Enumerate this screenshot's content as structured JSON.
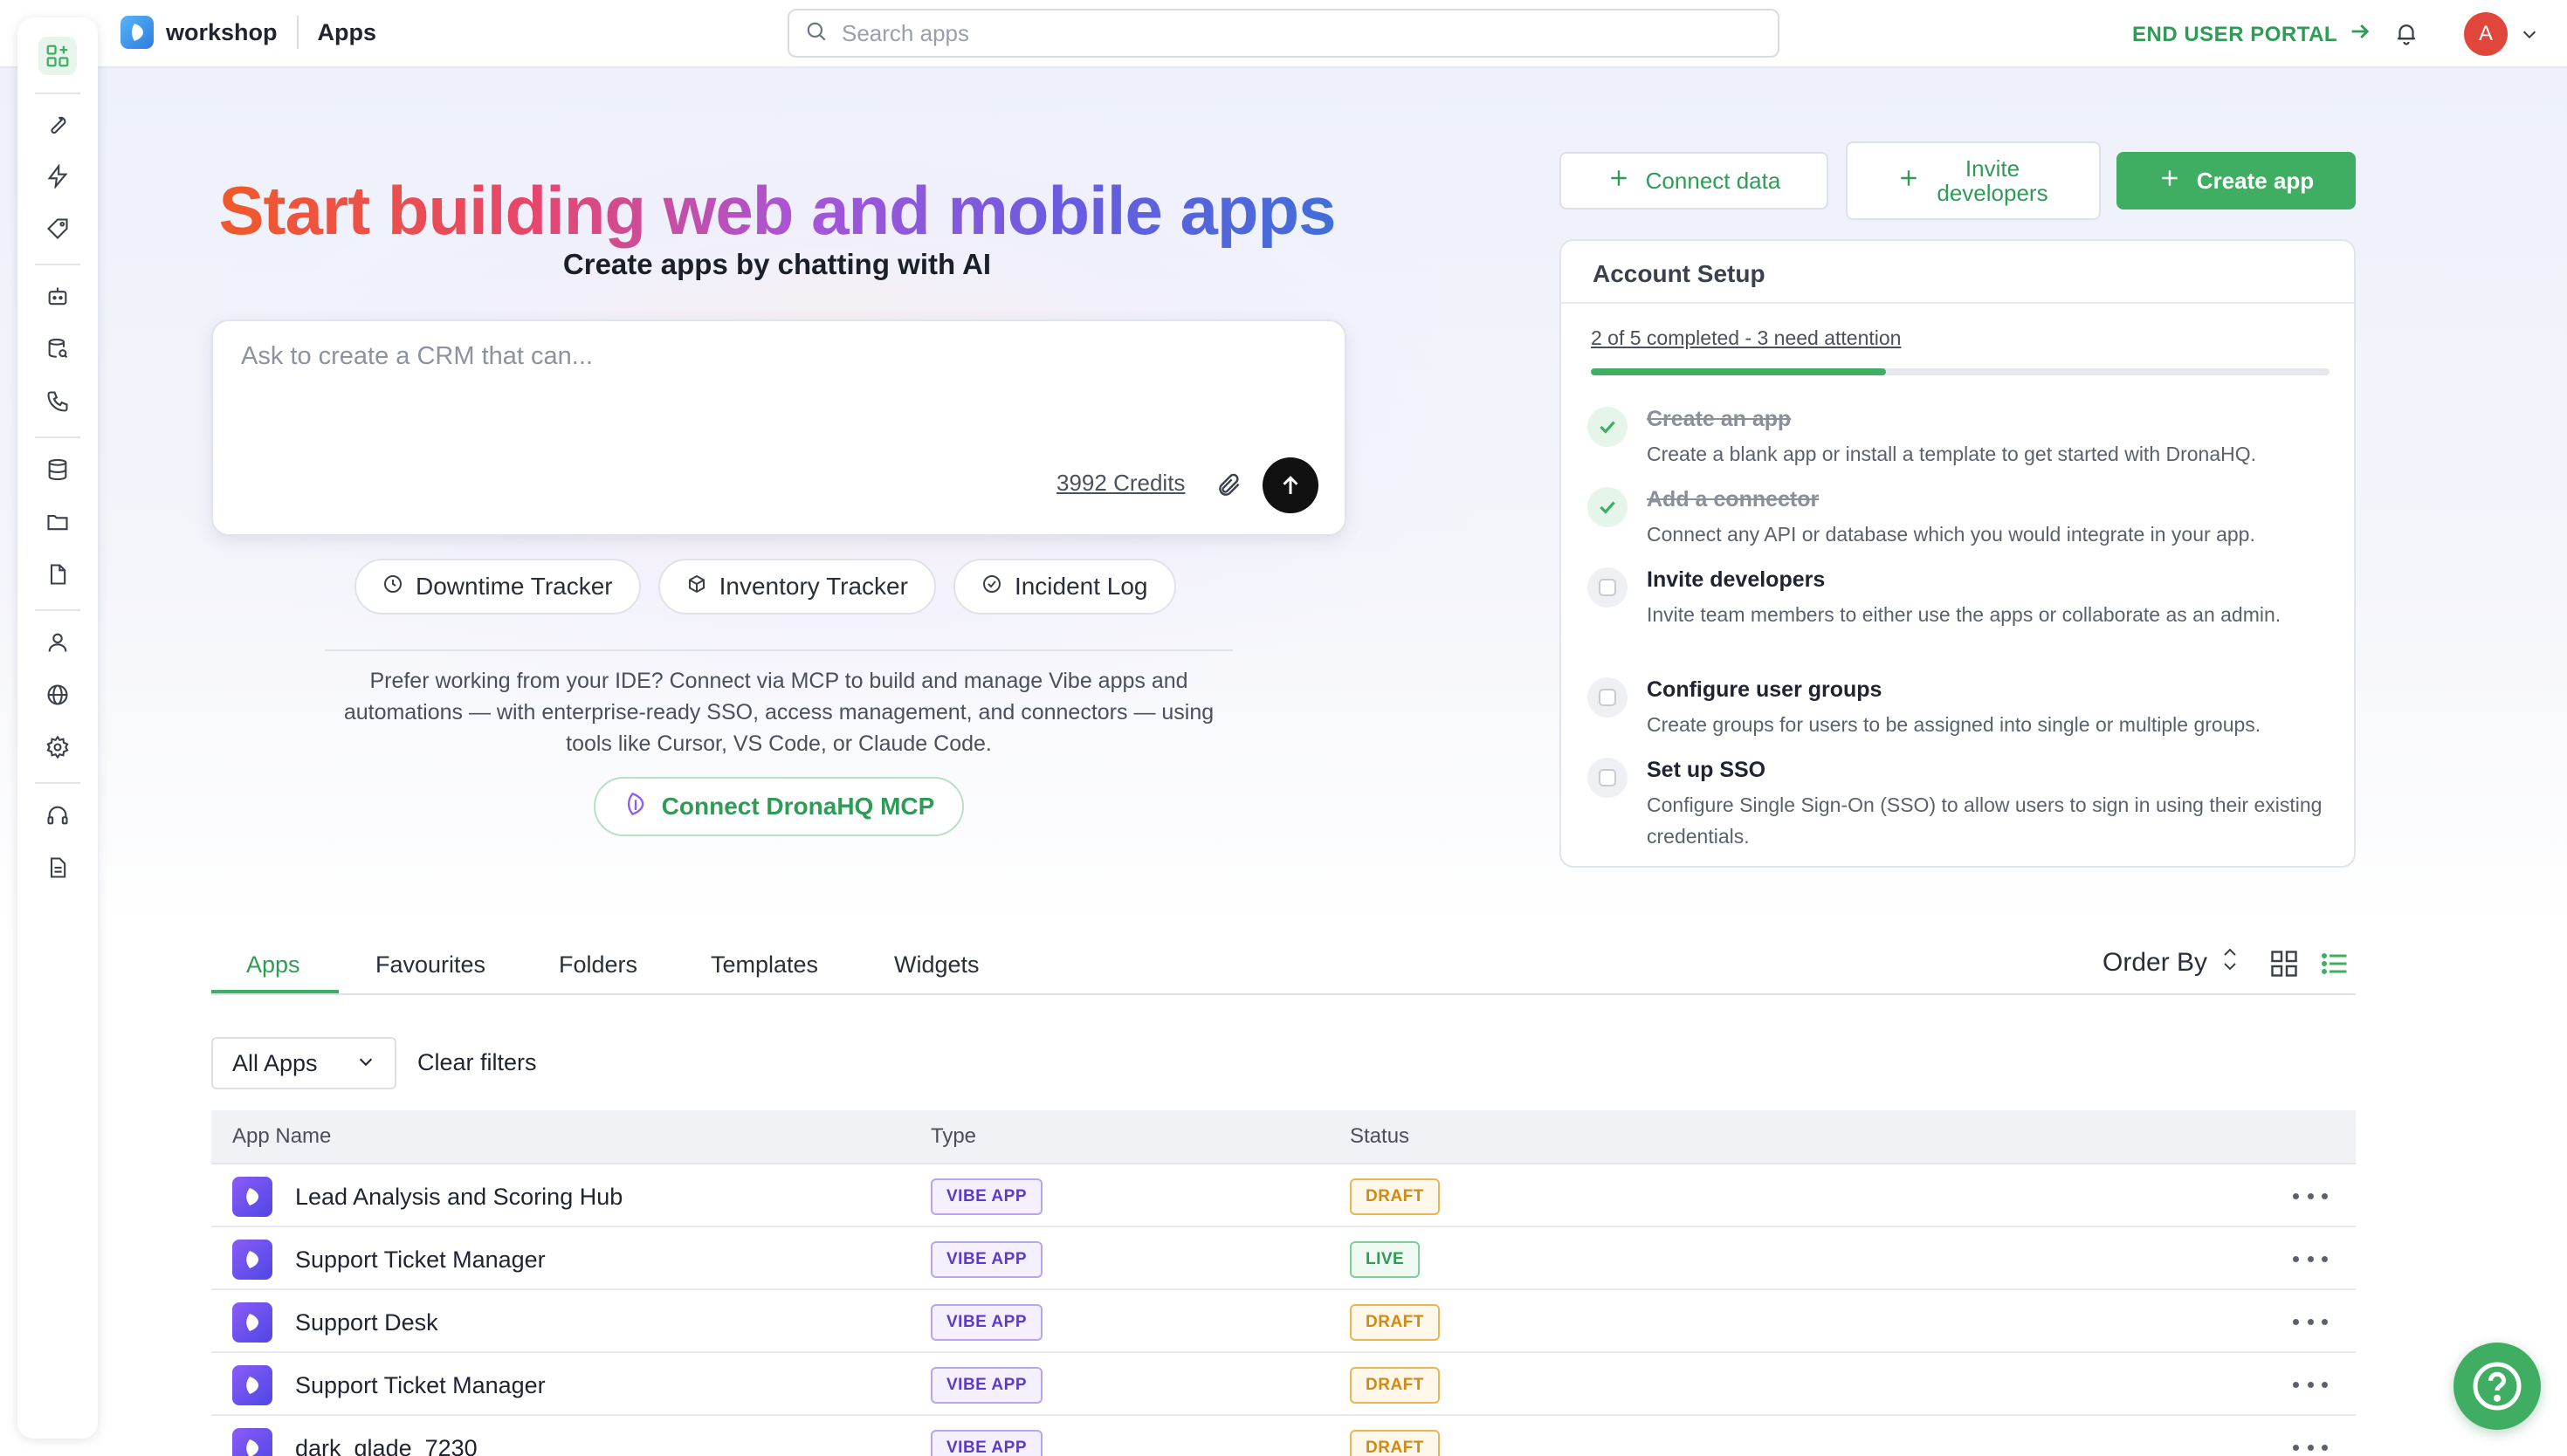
{
  "brand": {
    "name": "workshop",
    "section": "Apps"
  },
  "search": {
    "placeholder": "Search apps"
  },
  "header": {
    "portal_label": "END USER PORTAL",
    "avatar_initial": "A"
  },
  "colors": {
    "accent": "#3fae62",
    "accent_text": "#2f9b57",
    "avatar": "#e0463a",
    "vibe_badge": "#5b3cc4",
    "draft_badge": "#d08a14"
  },
  "sidebar": {
    "items": [
      {
        "icon": "apps-grid-icon",
        "active": true
      },
      {
        "icon": "wrench-icon"
      },
      {
        "icon": "lightning-icon"
      },
      {
        "icon": "tag-icon"
      },
      {
        "icon": "bot-icon"
      },
      {
        "icon": "database-search-icon"
      },
      {
        "icon": "phone-icon"
      },
      {
        "icon": "database-icon"
      },
      {
        "icon": "folder-icon"
      },
      {
        "icon": "file-icon"
      },
      {
        "icon": "user-icon"
      },
      {
        "icon": "globe-icon"
      },
      {
        "icon": "gear-icon"
      },
      {
        "icon": "headset-icon"
      },
      {
        "icon": "document-list-icon"
      }
    ]
  },
  "hero": {
    "title": "Start building web and mobile apps",
    "subtitle": "Create apps by chatting with AI",
    "prompt_placeholder": "Ask to create a CRM that can...",
    "credits": "3992 Credits",
    "chips": [
      "Downtime Tracker",
      "Inventory Tracker",
      "Incident Log"
    ],
    "mcp_text": "Prefer working from your IDE? Connect via MCP to build and manage Vibe apps and automations — with enterprise-ready SSO, access management, and connectors — using tools like Cursor, VS Code, or Claude Code.",
    "mcp_button": "Connect DronaHQ MCP"
  },
  "actions": {
    "connect_data": "Connect data",
    "invite_developers": "Invite developers",
    "create_app": "Create app"
  },
  "setup": {
    "title": "Account Setup",
    "progress_text": "2 of 5 completed - 3 need attention",
    "progress_fraction": 0.4,
    "tasks": [
      {
        "title": "Create an app",
        "desc": "Create a blank app or install a template to get started with DronaHQ.",
        "done": true
      },
      {
        "title": "Add a connector",
        "desc": "Connect any API or database which you would integrate in your app.",
        "done": true
      },
      {
        "title": "Invite developers",
        "desc": "Invite team members to either use the apps or collaborate as an admin.",
        "done": false
      },
      {
        "title": "Configure user groups",
        "desc": "Create groups for users to be assigned into single or multiple groups.",
        "done": false
      },
      {
        "title": "Set up SSO",
        "desc": "Configure Single Sign-On (SSO) to allow users to sign in using their existing credentials.",
        "done": false
      }
    ]
  },
  "tabs": [
    "Apps",
    "Favourites",
    "Folders",
    "Templates",
    "Widgets"
  ],
  "order_by_label": "Order By",
  "filters": {
    "selected": "All Apps",
    "clear_label": "Clear filters"
  },
  "table": {
    "columns": [
      "App Name",
      "Type",
      "Status"
    ],
    "rows": [
      {
        "name": "Lead Analysis and Scoring Hub",
        "type": "VIBE APP",
        "status": "DRAFT"
      },
      {
        "name": "Support Ticket Manager",
        "type": "VIBE APP",
        "status": "LIVE"
      },
      {
        "name": "Support Desk",
        "type": "VIBE APP",
        "status": "DRAFT"
      },
      {
        "name": "Support Ticket Manager",
        "type": "VIBE APP",
        "status": "DRAFT"
      },
      {
        "name": "dark_glade_7230",
        "type": "VIBE APP",
        "status": "DRAFT"
      }
    ]
  }
}
